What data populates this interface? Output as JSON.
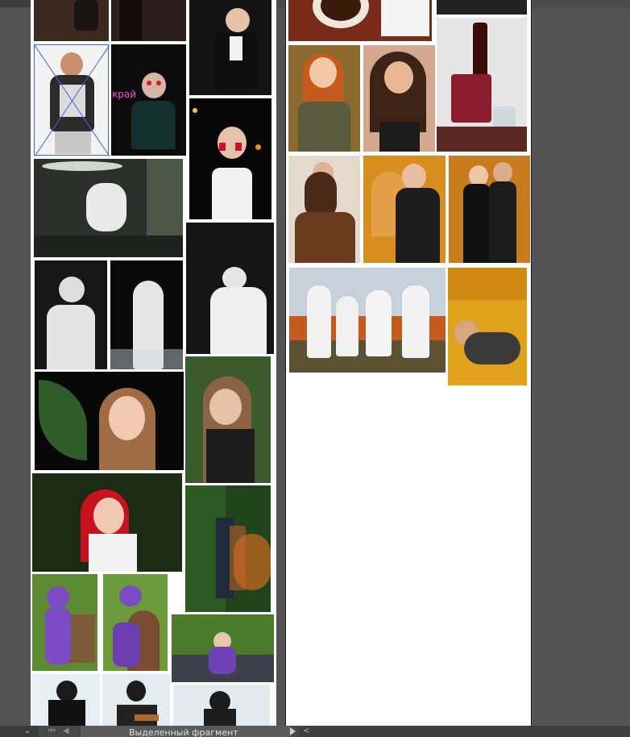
{
  "window": {
    "status_bar": {
      "field_label": "Выделенный фрагмент",
      "nav_first_icon": "first-frame-icon",
      "nav_prev_icon": "prev-frame-icon",
      "play_icon": "play-icon",
      "zoom_icon": "chevron-down-icon",
      "scroll_icon": "chevron-left-icon"
    }
  },
  "canvas": {
    "background": "#535353",
    "artboard_color": "#ffffff",
    "selection_color": "#3f66d9",
    "overlay_text_color": "#ff4fd6",
    "overlay_text": "край"
  }
}
